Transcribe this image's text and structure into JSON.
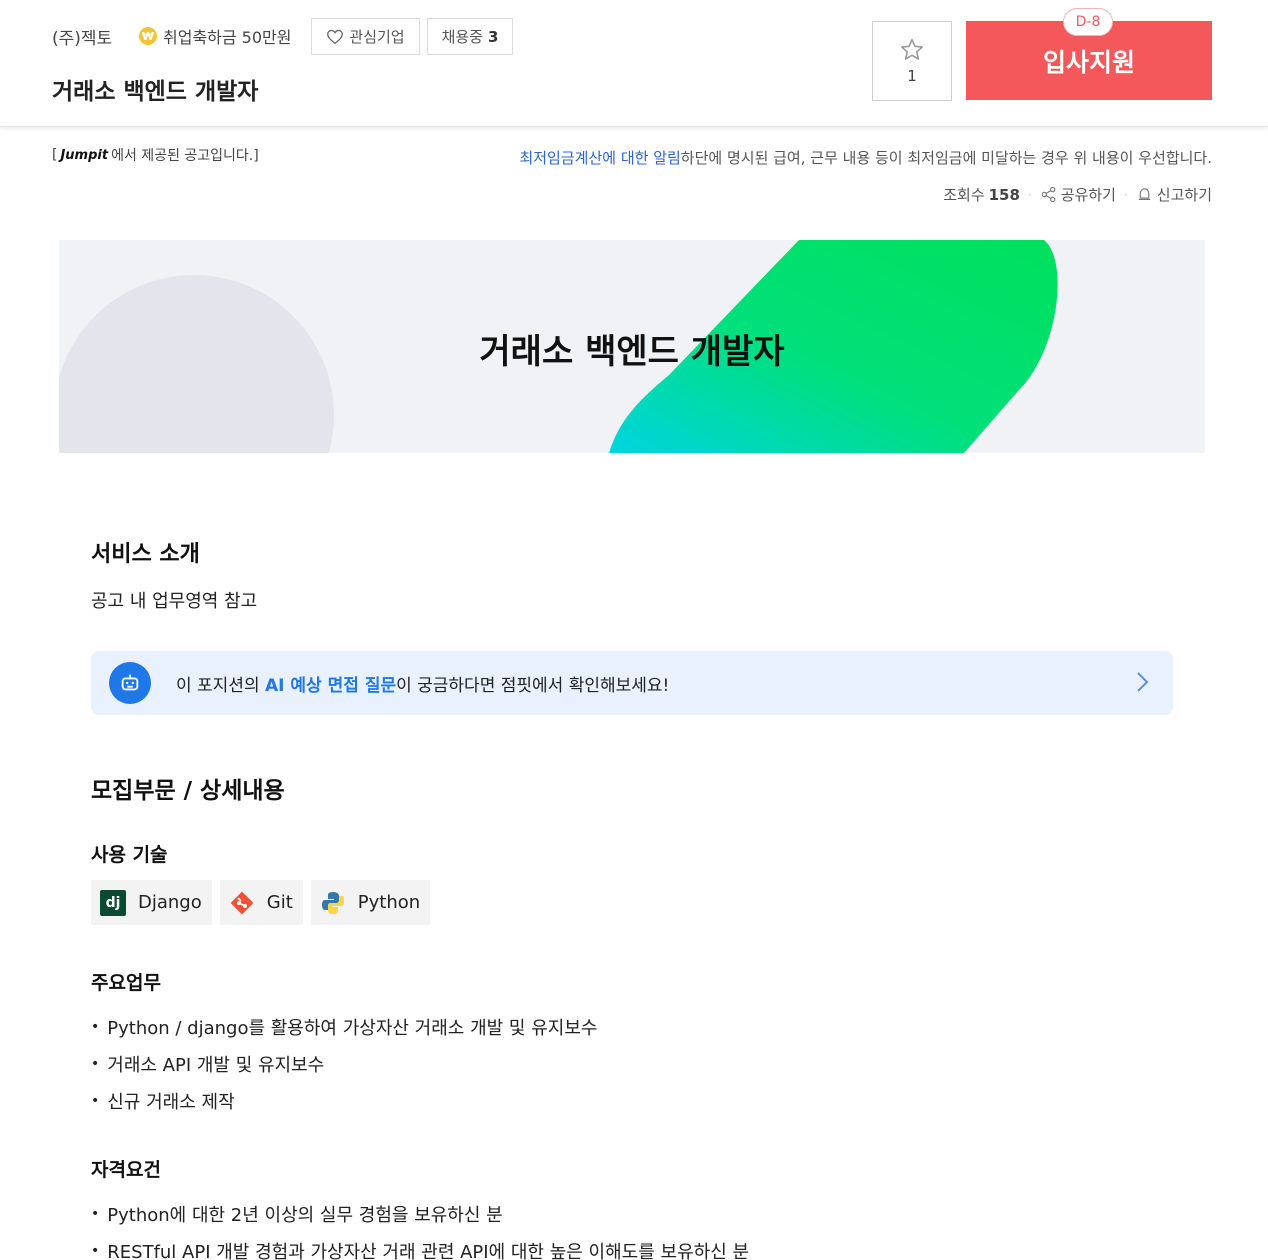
{
  "header": {
    "company": "(주)젝토",
    "bonus": "취업축하금 50만원",
    "interest_label": "관심기업",
    "hiring_label": "채용중",
    "hiring_count": "3",
    "job_title": "거래소 백엔드 개발자",
    "favorite_count": "1",
    "dday": "D-8",
    "apply_label": "입사지원"
  },
  "info": {
    "source_prefix": "[",
    "source_logo": "Jumpit",
    "source_suffix": "에서 제공된 공고입니다.]",
    "notice_link": "최저임금계산에 대한 알림",
    "notice_text": "하단에 명시된 급여, 근무 내용 등이 최저임금에 미달하는 경우 위 내용이 우선합니다.",
    "views_label": "조회수",
    "views_count": "158",
    "share_label": "공유하기",
    "report_label": "신고하기"
  },
  "banner": {
    "title": "거래소 백엔드 개발자"
  },
  "service": {
    "heading": "서비스 소개",
    "text": "공고 내 업무영역 참고"
  },
  "ai_prompt": {
    "prefix": "이 포지션의 ",
    "highlight": "AI 예상 면접 질문",
    "suffix": "이 궁금하다면 점핏에서 확인해보세요!"
  },
  "recruit": {
    "heading": "모집부문 / 상세내용",
    "skills_heading": "사용 기술",
    "skills": [
      {
        "name": "Django",
        "icon": "django-icon"
      },
      {
        "name": "Git",
        "icon": "git-icon"
      },
      {
        "name": "Python",
        "icon": "python-icon"
      }
    ],
    "duties_heading": "주요업무",
    "duties": [
      "Python / django를 활용하여 가상자산 거래소 개발 및 유지보수",
      "거래소 API 개발 및 유지보수",
      "신규 거래소 제작"
    ],
    "qual_heading": "자격요건",
    "quals": [
      "Python에 대한 2년 이상의 실무 경험을 보유하신 분",
      "RESTful API 개발 경험과 가상자산 거래 관련 API에 대한 높은 이해도를 보유하신 분"
    ]
  },
  "colors": {
    "apply": "#f4585a",
    "accent_blue": "#1f77e8",
    "link_blue": "#2c64d4"
  }
}
